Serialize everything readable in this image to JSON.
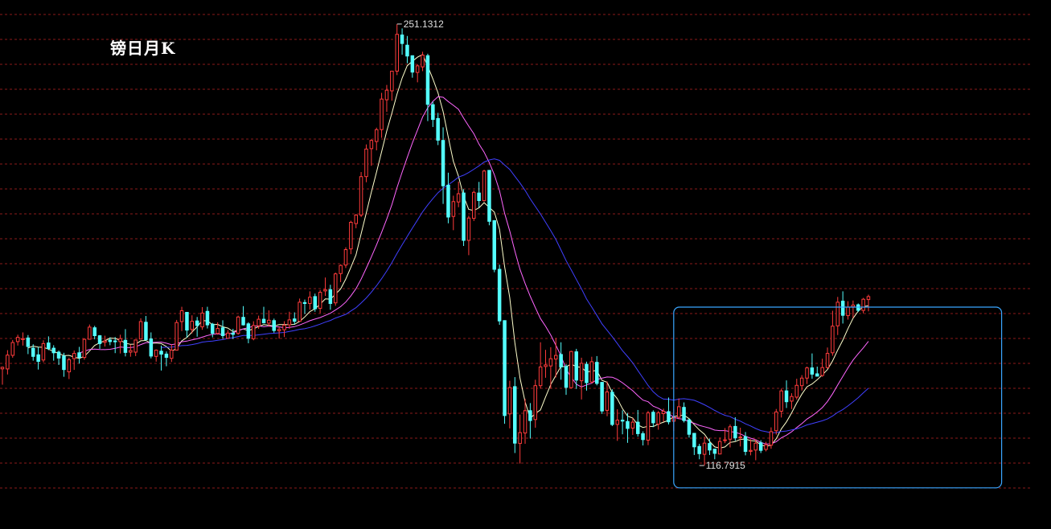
{
  "chart_title": "镑日月K",
  "colors": {
    "background": "#000000",
    "grid": "#8b1a1a",
    "up_candle": "#ff3b3b",
    "down_candle": "#54ffff",
    "ma_short": "#ffffcc",
    "ma_mid": "#ff66ff",
    "ma_long": "#4040ff",
    "highlight_box": "#3aa6ff"
  },
  "chart_data": {
    "type": "candlestick",
    "title": "镑日月K",
    "grid": true,
    "y_range": [
      108,
      256
    ],
    "max_label": "251.1312",
    "min_label": "116.7915",
    "price_max": 251.1312,
    "price_min": 116.7915,
    "max_index": 77,
    "min_index": 136,
    "highlight_range": [
      131,
      184
    ],
    "ma_periods": [
      6,
      16,
      32
    ],
    "ohlc": [
      [
        146.2,
        146.9,
        141.4,
        146.7
      ],
      [
        146.2,
        151.9,
        144.5,
        150.4
      ],
      [
        150.3,
        155.0,
        149.6,
        154.2
      ],
      [
        154.5,
        156.6,
        153.3,
        155.8
      ],
      [
        155.1,
        157.3,
        153.3,
        155.4
      ],
      [
        155.6,
        156.5,
        150.7,
        153.0
      ],
      [
        152.5,
        153.7,
        148.7,
        150.0
      ],
      [
        150.5,
        152.9,
        146.0,
        148.5
      ],
      [
        148.9,
        154.9,
        148.2,
        153.9
      ],
      [
        154.1,
        156.1,
        151.9,
        152.4
      ],
      [
        152.5,
        153.4,
        148.7,
        151.1
      ],
      [
        151.3,
        151.8,
        147.4,
        149.5
      ],
      [
        150.1,
        151.1,
        143.8,
        146.0
      ],
      [
        145.3,
        149.6,
        143.1,
        149.0
      ],
      [
        149.3,
        151.8,
        145.9,
        150.9
      ],
      [
        151.1,
        152.9,
        147.8,
        149.7
      ],
      [
        149.7,
        155.5,
        149.0,
        155.2
      ],
      [
        155.2,
        159.7,
        155.2,
        158.9
      ],
      [
        158.7,
        159.3,
        155.2,
        156.3
      ],
      [
        156.3,
        156.5,
        152.3,
        153.9
      ],
      [
        154.3,
        156.3,
        153.0,
        154.7
      ],
      [
        155.0,
        155.8,
        153.4,
        154.5
      ],
      [
        154.7,
        155.9,
        151.0,
        154.5
      ],
      [
        154.5,
        156.6,
        150.9,
        155.4
      ],
      [
        154.9,
        158.3,
        150.0,
        151.2
      ],
      [
        151.3,
        153.6,
        149.9,
        151.8
      ],
      [
        151.3,
        155.1,
        150.1,
        155.0
      ],
      [
        155.3,
        161.6,
        155.3,
        160.6
      ],
      [
        160.4,
        162.3,
        154.8,
        155.1
      ],
      [
        155.3,
        157.3,
        149.4,
        150.1
      ],
      [
        150.0,
        152.1,
        148.4,
        151.9
      ],
      [
        151.6,
        153.3,
        145.7,
        150.7
      ],
      [
        150.7,
        151.5,
        147.0,
        149.7
      ],
      [
        149.4,
        153.6,
        148.3,
        151.9
      ],
      [
        151.9,
        161.1,
        151.8,
        160.3
      ],
      [
        160.6,
        165.1,
        157.7,
        163.9
      ],
      [
        163.4,
        163.4,
        155.8,
        158.0
      ],
      [
        158.2,
        162.5,
        157.0,
        160.7
      ],
      [
        160.8,
        162.0,
        156.0,
        159.4
      ],
      [
        159.0,
        165.0,
        158.1,
        163.2
      ],
      [
        163.7,
        165.1,
        158.5,
        159.6
      ],
      [
        159.8,
        160.2,
        155.8,
        157.0
      ],
      [
        157.0,
        160.4,
        156.6,
        158.5
      ],
      [
        158.7,
        161.0,
        155.4,
        156.3
      ],
      [
        155.5,
        158.0,
        155.4,
        157.1
      ],
      [
        157.1,
        158.4,
        155.3,
        156.7
      ],
      [
        157.0,
        162.4,
        156.6,
        162.0
      ],
      [
        161.9,
        165.3,
        159.4,
        159.6
      ],
      [
        159.9,
        160.4,
        154.0,
        155.5
      ],
      [
        155.4,
        160.7,
        154.9,
        159.4
      ],
      [
        159.3,
        162.4,
        158.4,
        161.3
      ],
      [
        161.3,
        165.1,
        160.0,
        160.2
      ],
      [
        160.1,
        164.0,
        159.1,
        161.0
      ],
      [
        160.9,
        161.5,
        157.2,
        157.9
      ],
      [
        157.8,
        159.0,
        155.4,
        158.2
      ],
      [
        158.1,
        160.7,
        155.9,
        159.5
      ],
      [
        159.6,
        163.6,
        158.4,
        161.1
      ],
      [
        161.4,
        163.4,
        159.8,
        160.7
      ],
      [
        160.7,
        167.6,
        160.7,
        166.5
      ],
      [
        166.4,
        167.3,
        162.9,
        166.1
      ],
      [
        166.1,
        169.8,
        164.2,
        168.0
      ],
      [
        168.2,
        169.1,
        163.6,
        164.5
      ],
      [
        164.6,
        170.2,
        163.2,
        169.5
      ],
      [
        169.9,
        174.0,
        168.4,
        170.3
      ],
      [
        170.3,
        171.8,
        164.2,
        166.1
      ],
      [
        166.3,
        175.5,
        165.4,
        175.1
      ],
      [
        175.2,
        178.0,
        172.6,
        177.7
      ],
      [
        177.8,
        183.2,
        176.9,
        182.5
      ],
      [
        182.7,
        191.3,
        181.1,
        190.8
      ],
      [
        190.4,
        193.3,
        189.0,
        193.0
      ],
      [
        193.0,
        206.1,
        192.4,
        204.7
      ],
      [
        204.7,
        214.5,
        203.0,
        213.1
      ],
      [
        213.2,
        216.1,
        208.0,
        215.7
      ],
      [
        215.4,
        219.6,
        212.7,
        219.0
      ],
      [
        219.0,
        230.2,
        216.5,
        228.3
      ],
      [
        228.1,
        232.6,
        224.4,
        231.0
      ],
      [
        230.8,
        236.9,
        227.8,
        236.8
      ],
      [
        236.8,
        251.1,
        235.6,
        248.0
      ],
      [
        247.8,
        249.8,
        241.8,
        245.2
      ],
      [
        244.7,
        247.5,
        239.2,
        241.4
      ],
      [
        241.5,
        241.6,
        234.8,
        236.5
      ],
      [
        236.4,
        238.9,
        233.4,
        238.4
      ],
      [
        238.1,
        242.7,
        236.8,
        241.7
      ],
      [
        241.5,
        242.1,
        221.6,
        226.7
      ],
      [
        226.6,
        227.5,
        219.8,
        222.1
      ],
      [
        222.4,
        224.1,
        214.3,
        215.8
      ],
      [
        215.7,
        219.7,
        196.4,
        201.9
      ],
      [
        202.1,
        205.9,
        190.5,
        192.4
      ],
      [
        192.6,
        198.9,
        188.4,
        197.1
      ],
      [
        197.0,
        203.2,
        195.4,
        199.5
      ],
      [
        199.7,
        200.9,
        183.6,
        185.3
      ],
      [
        185.3,
        192.8,
        180.8,
        192.1
      ],
      [
        192.0,
        200.5,
        191.2,
        199.9
      ],
      [
        199.7,
        203.1,
        195.3,
        197.4
      ],
      [
        197.4,
        206.8,
        197.1,
        206.4
      ],
      [
        206.6,
        206.7,
        189.9,
        191.1
      ],
      [
        191.3,
        191.5,
        175.6,
        176.5
      ],
      [
        176.5,
        177.9,
        159.6,
        160.8
      ],
      [
        160.9,
        161.0,
        129.5,
        132.0
      ],
      [
        132.5,
        142.6,
        128.1,
        140.5
      ],
      [
        140.8,
        143.7,
        120.6,
        123.6
      ],
      [
        123.5,
        132.3,
        117.4,
        126.8
      ],
      [
        126.7,
        137.1,
        123.4,
        133.5
      ],
      [
        133.5,
        135.8,
        125.0,
        130.5
      ],
      [
        130.8,
        142.9,
        128.3,
        141.1
      ],
      [
        141.1,
        154.3,
        140.2,
        146.8
      ],
      [
        146.9,
        152.0,
        143.5,
        147.4
      ],
      [
        147.1,
        152.8,
        140.2,
        149.3
      ],
      [
        149.2,
        155.6,
        143.6,
        150.3
      ],
      [
        150.6,
        154.3,
        142.9,
        146.8
      ],
      [
        146.9,
        147.6,
        138.3,
        140.6
      ],
      [
        140.5,
        151.7,
        140.2,
        151.5
      ],
      [
        151.4,
        152.3,
        140.1,
        142.8
      ],
      [
        142.6,
        149.6,
        136.9,
        147.9
      ],
      [
        147.6,
        148.4,
        139.6,
        142.0
      ],
      [
        142.2,
        149.9,
        141.8,
        148.4
      ],
      [
        148.2,
        150.1,
        141.2,
        141.8
      ],
      [
        142.1,
        142.2,
        132.5,
        133.4
      ],
      [
        133.6,
        142.4,
        131.8,
        139.2
      ],
      [
        139.1,
        140.0,
        128.8,
        129.3
      ],
      [
        129.3,
        133.9,
        124.3,
        130.6
      ],
      [
        130.6,
        133.6,
        126.3,
        130.3
      ],
      [
        130.2,
        132.8,
        123.7,
        128.1
      ],
      [
        128.2,
        131.2,
        126.1,
        130.0
      ],
      [
        130.0,
        133.7,
        125.6,
        126.5
      ],
      [
        126.5,
        127.2,
        122.9,
        124.7
      ],
      [
        124.5,
        133.4,
        123.0,
        132.8
      ],
      [
        133.0,
        133.6,
        128.5,
        129.8
      ],
      [
        129.4,
        133.4,
        127.7,
        132.8
      ],
      [
        132.6,
        134.1,
        130.1,
        133.3
      ],
      [
        133.2,
        137.5,
        129.3,
        130.1
      ],
      [
        130.3,
        134.0,
        127.3,
        131.3
      ],
      [
        131.5,
        137.2,
        130.9,
        134.7
      ],
      [
        134.5,
        136.0,
        129.9,
        130.5
      ],
      [
        130.7,
        131.0,
        125.3,
        126.3
      ],
      [
        126.6,
        126.7,
        120.0,
        122.5
      ],
      [
        122.6,
        123.4,
        118.7,
        120.4
      ],
      [
        120.2,
        125.6,
        116.8,
        123.6
      ],
      [
        123.5,
        125.0,
        120.0,
        121.5
      ],
      [
        121.8,
        121.9,
        118.7,
        120.5
      ],
      [
        120.3,
        125.3,
        120.2,
        124.1
      ],
      [
        124.4,
        128.2,
        123.6,
        124.6
      ],
      [
        124.8,
        129.3,
        122.3,
        128.6
      ],
      [
        128.7,
        131.5,
        124.3,
        125.2
      ],
      [
        125.4,
        128.3,
        122.6,
        125.5
      ],
      [
        125.6,
        127.0,
        119.9,
        121.1
      ],
      [
        121.1,
        124.8,
        119.9,
        121.4
      ],
      [
        121.5,
        124.8,
        118.4,
        123.6
      ],
      [
        123.7,
        124.5,
        120.6,
        121.4
      ],
      [
        121.7,
        124.0,
        121.1,
        123.1
      ],
      [
        123.0,
        128.4,
        121.9,
        127.1
      ],
      [
        127.4,
        134.0,
        126.2,
        133.1
      ],
      [
        133.3,
        140.2,
        131.4,
        139.5
      ],
      [
        139.5,
        142.7,
        134.3,
        136.2
      ],
      [
        136.4,
        138.8,
        134.0,
        137.8
      ],
      [
        137.6,
        143.2,
        136.9,
        141.2
      ],
      [
        141.1,
        144.3,
        139.6,
        143.4
      ],
      [
        143.4,
        146.9,
        141.6,
        146.5
      ],
      [
        146.5,
        150.9,
        143.2,
        144.6
      ],
      [
        144.7,
        146.9,
        143.9,
        144.0
      ],
      [
        144.2,
        149.3,
        143.8,
        146.6
      ],
      [
        146.6,
        152.7,
        146.3,
        150.9
      ],
      [
        151.1,
        163.9,
        150.2,
        159.2
      ],
      [
        159.3,
        168.1,
        156.5,
        166.5
      ],
      [
        166.8,
        169.8,
        160.0,
        162.5
      ],
      [
        162.4,
        166.8,
        161.2,
        165.0
      ],
      [
        165.1,
        167.0,
        161.7,
        165.6
      ],
      [
        165.7,
        166.1,
        163.5,
        164.0
      ],
      [
        164.0,
        167.8,
        163.1,
        167.4
      ],
      [
        167.3,
        168.8,
        163.7,
        168.2
      ]
    ]
  }
}
